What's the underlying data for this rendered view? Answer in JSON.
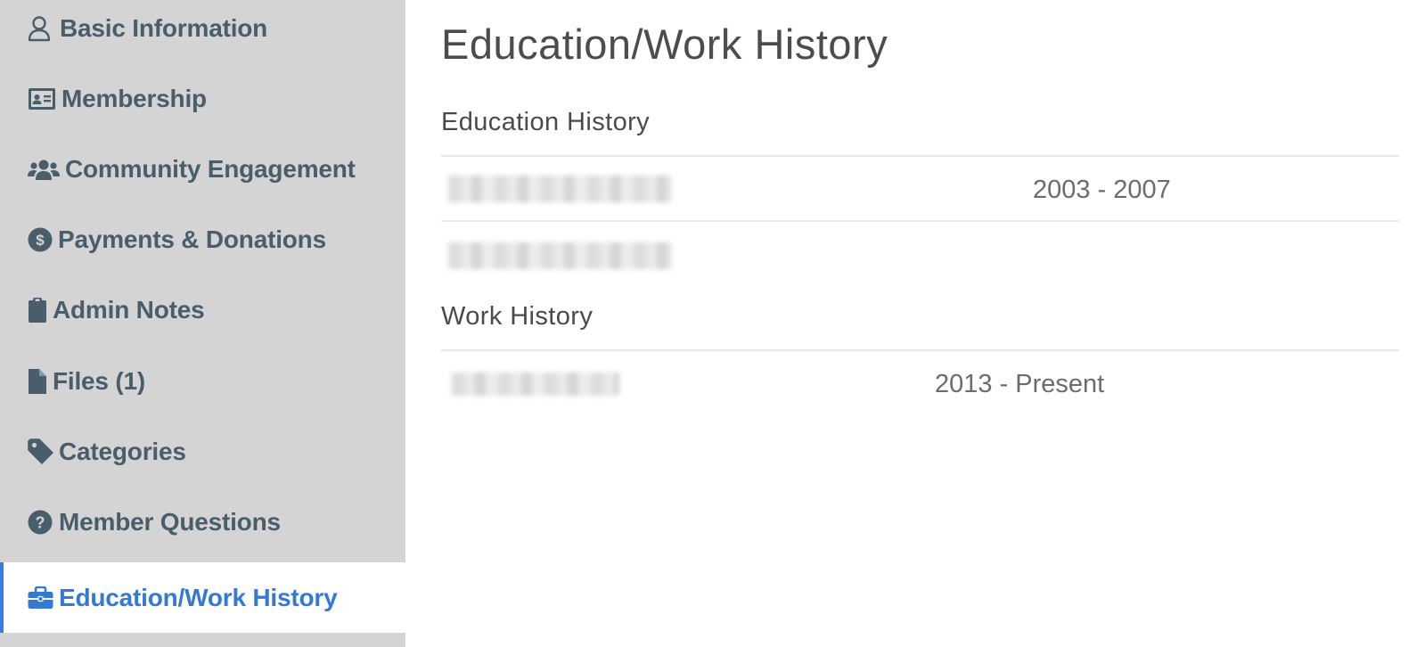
{
  "sidebar": {
    "items": [
      {
        "label": "Basic Information",
        "icon": "user-icon"
      },
      {
        "label": "Membership",
        "icon": "id-card-icon"
      },
      {
        "label": "Community Engagement",
        "icon": "users-icon"
      },
      {
        "label": "Payments & Donations",
        "icon": "dollar-circle-icon"
      },
      {
        "label": "Admin Notes",
        "icon": "clipboard-icon"
      },
      {
        "label": "Files (1)",
        "icon": "file-icon"
      },
      {
        "label": "Categories",
        "icon": "tag-icon"
      },
      {
        "label": "Member Questions",
        "icon": "question-circle-icon"
      },
      {
        "label": "Education/Work History",
        "icon": "briefcase-icon",
        "active": true
      }
    ]
  },
  "main": {
    "title": "Education/Work History",
    "education": {
      "heading": "Education History",
      "entries": [
        {
          "dates": "2003 - 2007"
        }
      ]
    },
    "work": {
      "heading": "Work History",
      "entries": [
        {
          "dates": "2013 - Present"
        }
      ]
    }
  },
  "colors": {
    "sidebar_bg": "#d4d4d4",
    "nav_text": "#495d6b",
    "active_text": "#3579d4",
    "active_border": "#3a7de0"
  }
}
